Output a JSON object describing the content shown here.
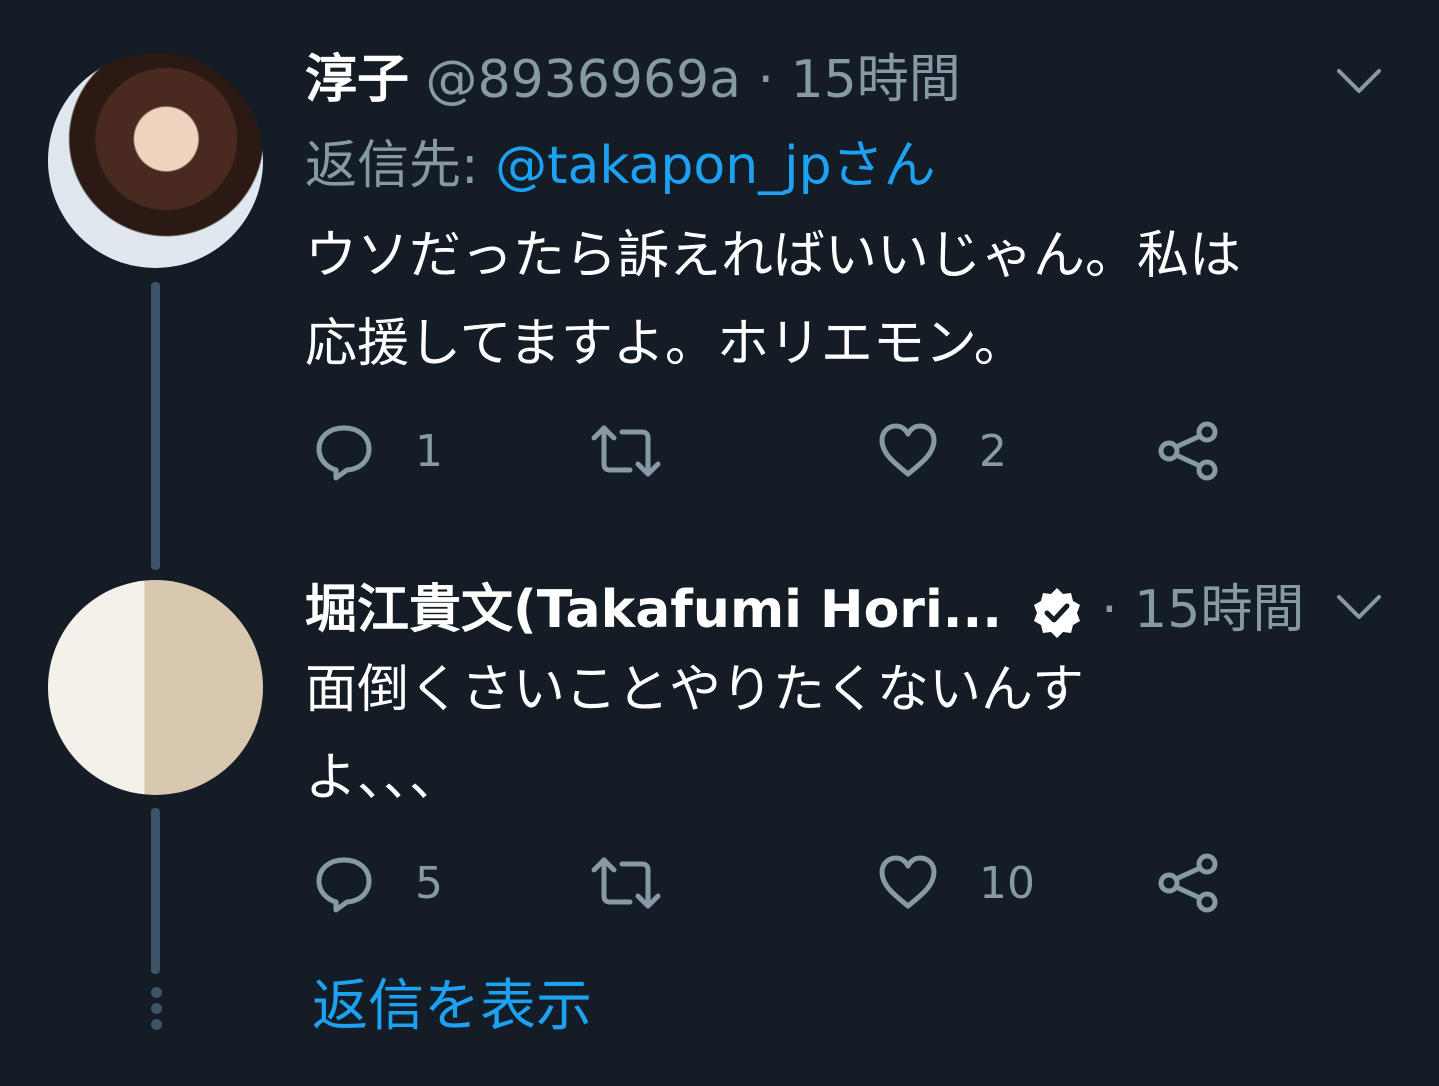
{
  "tweets": [
    {
      "name": "淳子",
      "handle": "@8936969a",
      "time": "15時間",
      "reply_prefix": "返信先:",
      "reply_to": "@takapon_jpさん",
      "text_line1": "ウソだったら訴えればいいじゃん。私は",
      "text_line2": "応援してますよ。ホリエモン。",
      "replies": "1",
      "retweets": "",
      "likes": "2"
    },
    {
      "name": "堀江貴文(Takafumi Hori...",
      "verified": true,
      "time": "15時間",
      "text_line1": "面倒くさいことやりたくないんす",
      "text_line2": "よ、、、",
      "replies": "5",
      "retweets": "",
      "likes": "10"
    }
  ],
  "show_replies": "返信を表示",
  "colors": {
    "background": "#141d26",
    "muted": "#8899a6",
    "accent": "#1da1f2",
    "thread": "#3d5466"
  },
  "icons": [
    "reply-icon",
    "retweet-icon",
    "like-icon",
    "share-icon",
    "chevron-down-icon",
    "verified-badge-icon"
  ]
}
